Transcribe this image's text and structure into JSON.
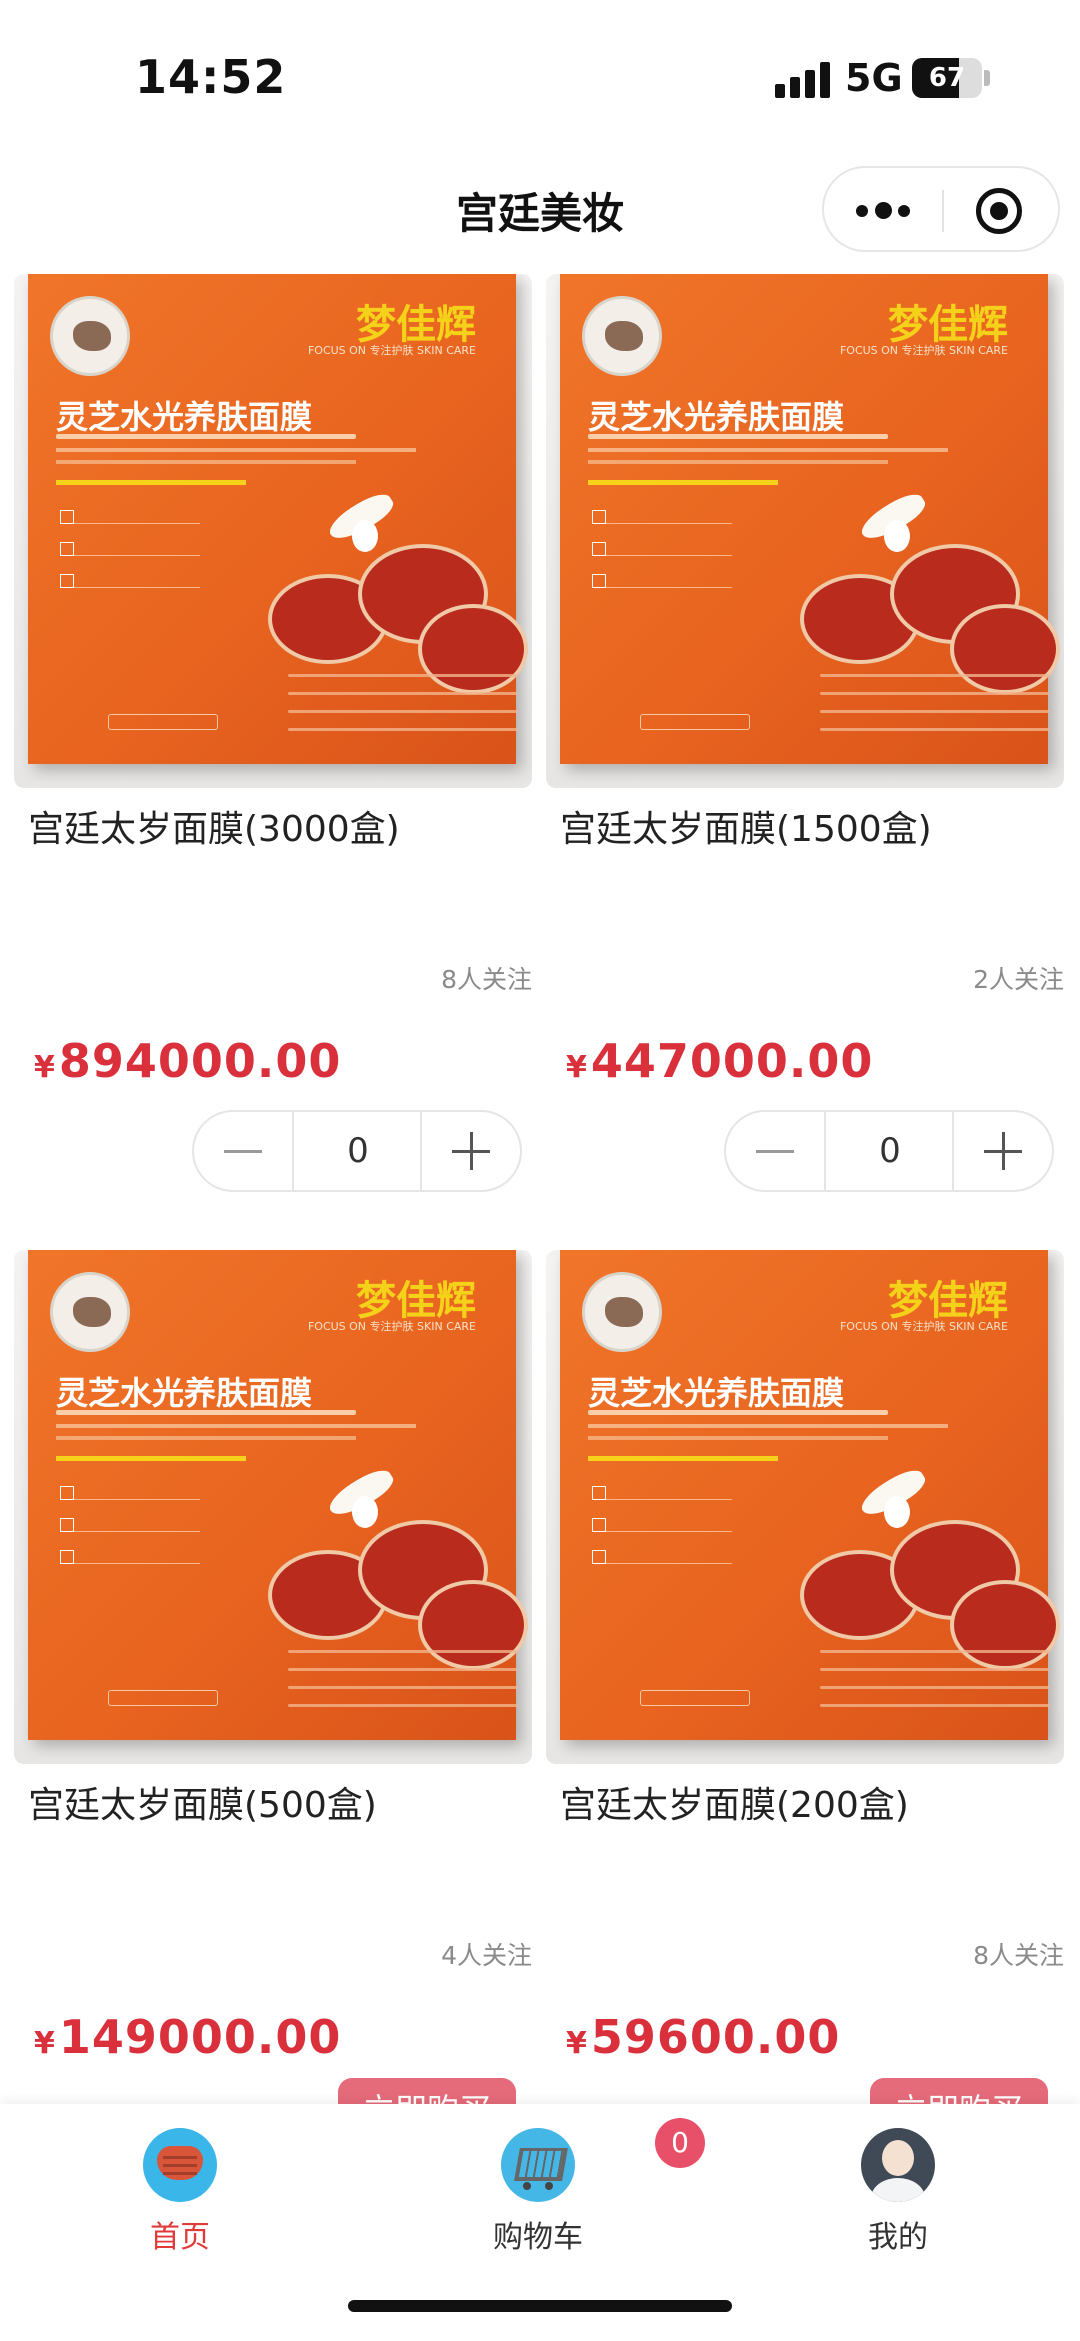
{
  "status_bar": {
    "time": "14:52",
    "network": "5G",
    "battery": "67",
    "battery_level": 0.67
  },
  "nav": {
    "title": "宫廷美妆",
    "more_icon": "more-dots-icon",
    "close_icon": "target-circle-icon"
  },
  "package_art": {
    "brand": "梦佳辉",
    "brand_sub": "FOCUS ON 专注护肤 SKIN CARE",
    "product_line": "灵芝水光养肤面膜"
  },
  "products": [
    {
      "name": "宫廷太岁面膜(3000盒)",
      "followers": "8人关注",
      "currency": "¥",
      "price": "894000.00",
      "qty": "0"
    },
    {
      "name": "宫廷太岁面膜(1500盒)",
      "followers": "2人关注",
      "currency": "¥",
      "price": "447000.00",
      "qty": "0"
    },
    {
      "name": "宫廷太岁面膜(500盒)",
      "followers": "4人关注",
      "currency": "¥",
      "price": "149000.00",
      "buy_label": "立即购买"
    },
    {
      "name": "宫廷太岁面膜(200盒)",
      "followers": "8人关注",
      "currency": "¥",
      "price": "59600.00",
      "buy_label": "立即购买"
    }
  ],
  "tabbar": {
    "active_color": "#e03a3a",
    "price_color": "#d9303c",
    "items": [
      {
        "label": "首页",
        "icon": "home-mask-icon"
      },
      {
        "label": "购物车",
        "icon": "shopping-cart-icon",
        "badge": "0"
      },
      {
        "label": "我的",
        "icon": "user-avatar-icon"
      }
    ]
  }
}
